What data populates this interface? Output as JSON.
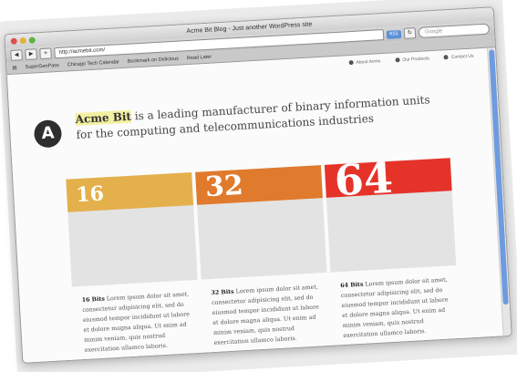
{
  "browser": {
    "title": "Acme Bit Blog - Just another WordPress site",
    "url": "http://acmebit.com/",
    "search_placeholder": "Google",
    "rss_label": "RSS",
    "bookmarks": [
      "SuperGenPass",
      "Chicago Tech Calendar",
      "Bookmark on Delicious",
      "Read Later"
    ]
  },
  "page": {
    "nav": [
      "About Acme",
      "Our Products",
      "Contact Us"
    ],
    "logo_letter": "A",
    "headline_brand": "Acme Bit",
    "headline_rest": " is a leading manufacturer of binary information units for the computing and telecommunications industries",
    "cards": [
      {
        "number": "16",
        "color": "#E3B04B",
        "title": "16 Bits",
        "text": "Lorem ipsum dolor sit amet, consectetur adipisicing elit, sed do eiusmod tempor incididunt ut labore et dolore magna aliqua. Ut enim ad minim veniam, quis nostrud exercitation ullamco laboris."
      },
      {
        "number": "32",
        "color": "#E07A2C",
        "title": "32 Bits",
        "text": "Lorem ipsum dolor sit amet, consectetur adipisicing elit, sed do eiusmod tempor incididunt ut labore et dolore magna aliqua. Ut enim ad minim veniam, quis nostrud exercitation ullamco laboris."
      },
      {
        "number": "64",
        "color": "#E6332A",
        "title": "64 Bits",
        "text": "Lorem ipsum dolor sit amet, consectetur adipisicing elit, sed do eiusmod tempor incididunt ut labore et dolore magna aliqua. Ut enim ad minim veniam, quis nostrud exercitation ullamco laboris."
      }
    ]
  }
}
